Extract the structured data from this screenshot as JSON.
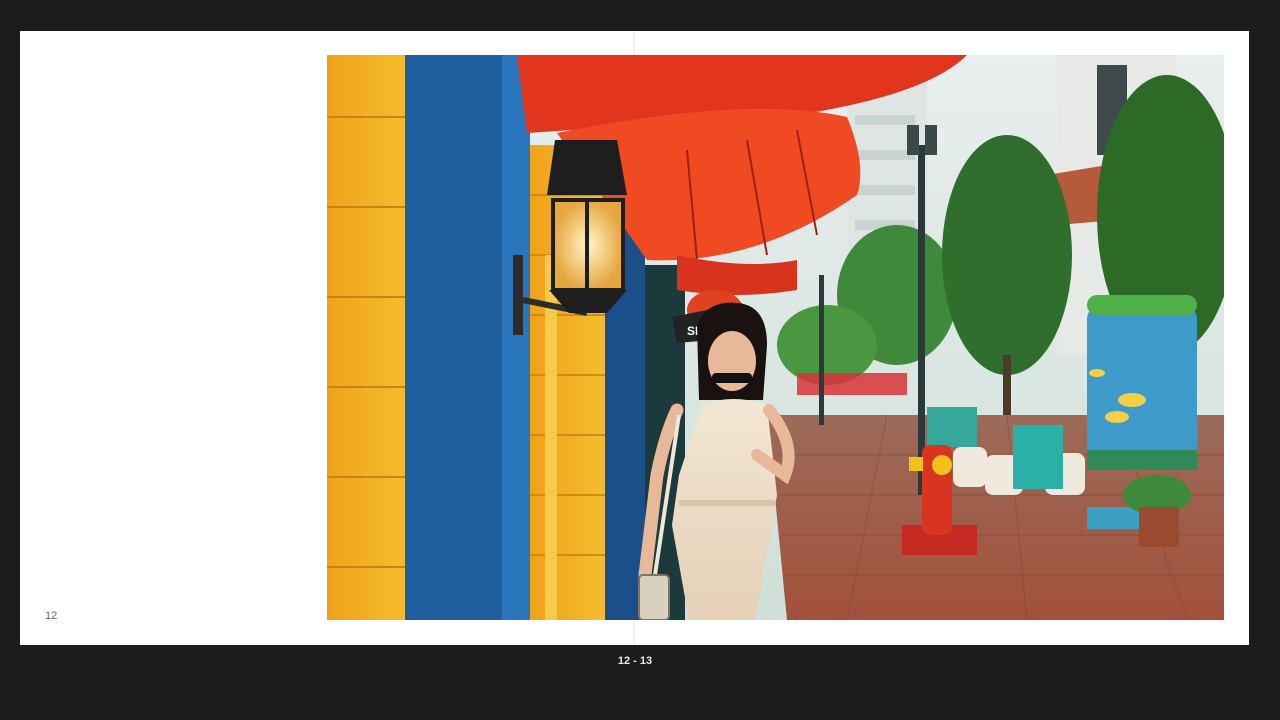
{
  "book": {
    "left_page_number": "12",
    "spread_label": "12 - 13"
  },
  "photo": {
    "subject": "woman-in-white-dress",
    "shop_sign_text": "SHR"
  },
  "colors": {
    "viewer_background": "#1c1c1c",
    "page_background": "#ffffff",
    "awning_red": "#e8321c",
    "wall_blue": "#1f5fa0",
    "wall_yellow": "#f2b41c"
  }
}
